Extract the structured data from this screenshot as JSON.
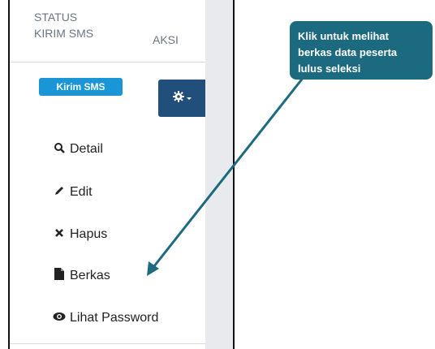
{
  "table": {
    "header_status": "STATUS",
    "header_kirim_sms": "KIRIM SMS",
    "header_aksi": "AKSI",
    "kirim_button": "Kirim SMS"
  },
  "dropdown": {
    "items": [
      {
        "label": "Detail",
        "icon": "search-icon"
      },
      {
        "label": "Edit",
        "icon": "pencil-icon"
      },
      {
        "label": "Hapus",
        "icon": "times-icon"
      },
      {
        "label": "Berkas",
        "icon": "file-icon"
      },
      {
        "label": "Lihat Password",
        "icon": "eye-icon"
      }
    ]
  },
  "callout": {
    "line1": "Klik untuk melihat",
    "line2": "berkas data peserta",
    "line3": "lulus seleksi"
  },
  "colors": {
    "callout_bg": "#1c6a80",
    "kirim_bg": "#1a95d6",
    "gear_bg": "#1f4f7a"
  }
}
